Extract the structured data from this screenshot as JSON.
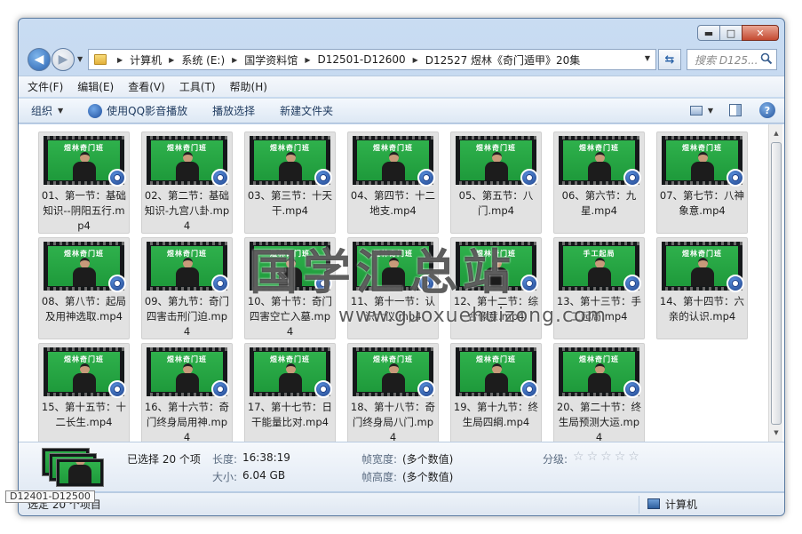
{
  "window": {
    "controls": {
      "minimize": "▬",
      "maximize": "□",
      "close": "✕"
    }
  },
  "nav": {
    "breadcrumbs": [
      "计算机",
      "系统 (E:)",
      "国学资料馆",
      "D12501-D12600",
      "D12527 煜林《奇门遁甲》20集"
    ],
    "search_placeholder": "搜索 D125..."
  },
  "menu": [
    "文件(F)",
    "编辑(E)",
    "查看(V)",
    "工具(T)",
    "帮助(H)"
  ],
  "toolbar": {
    "organize": "组织",
    "qq_play": "使用QQ影音播放",
    "play_selection": "播放选择",
    "new_folder": "新建文件夹"
  },
  "files": [
    {
      "name": "01、第一节：基础知识--阴阳五行.mp4",
      "banner": "煜林奇门班"
    },
    {
      "name": "02、第二节：基础知识-九宫八卦.mp4",
      "banner": "煜林奇门班"
    },
    {
      "name": "03、第三节：十天干.mp4",
      "banner": "煜林奇门班"
    },
    {
      "name": "04、第四节：十二地支.mp4",
      "banner": "煜林奇门班"
    },
    {
      "name": "05、第五节：八门.mp4",
      "banner": "煜林奇门班"
    },
    {
      "name": "06、第六节：九星.mp4",
      "banner": "煜林奇门班"
    },
    {
      "name": "07、第七节：八神象意.mp4",
      "banner": "煜林奇门班"
    },
    {
      "name": "08、第八节：起局及用神选取.mp4",
      "banner": "煜林奇门班"
    },
    {
      "name": "09、第九节：奇门四害击刑门迫.mp4",
      "banner": "煜林奇门班"
    },
    {
      "name": "10、第十节：奇门四害空亡入墓.mp4",
      "banner": "煜林奇门班"
    },
    {
      "name": "11、第十一节：认识六仪.mp4",
      "banner": "煜林奇门班"
    },
    {
      "name": "12、第十二节：综合像意.mp4",
      "banner": "煜林奇门班"
    },
    {
      "name": "13、第十三节：手工起局.mp4",
      "banner": "手工起局"
    },
    {
      "name": "14、第十四节：六亲的认识.mp4",
      "banner": "煜林奇门班"
    },
    {
      "name": "15、第十五节：十二长生.mp4",
      "banner": "煜林奇门班"
    },
    {
      "name": "16、第十六节：奇门终身局用神.mp4",
      "banner": "煜林奇门班"
    },
    {
      "name": "17、第十七节：日干能量比对.mp4",
      "banner": "煜林奇门班"
    },
    {
      "name": "18、第十八节：奇门终身局八门.mp4",
      "banner": "煜林奇门班"
    },
    {
      "name": "19、第十九节：终生局四綱.mp4",
      "banner": "煜林奇门班"
    },
    {
      "name": "20、第二十节：终生局预测大运.mp4",
      "banner": "煜林奇门班"
    }
  ],
  "watermark": {
    "text": "国学汇总站",
    "url": "www.guoxuehuizong.com"
  },
  "details": {
    "selected": "已选择 20 个项",
    "length_label": "长度:",
    "length_value": "16:38:19",
    "size_label": "大小:",
    "size_value": "6.04 GB",
    "frame_width_label": "帧宽度:",
    "frame_width_value": "(多个数值)",
    "frame_height_label": "帧高度:",
    "frame_height_value": "(多个数值)",
    "rating_label": "分级:"
  },
  "status": {
    "left": "选定 20 个项目",
    "right": "计算机",
    "tooltip": "D12401-D12500"
  },
  "colors": {
    "thumb_green": "#1e9a3b",
    "accent_blue": "#2a62b0"
  }
}
